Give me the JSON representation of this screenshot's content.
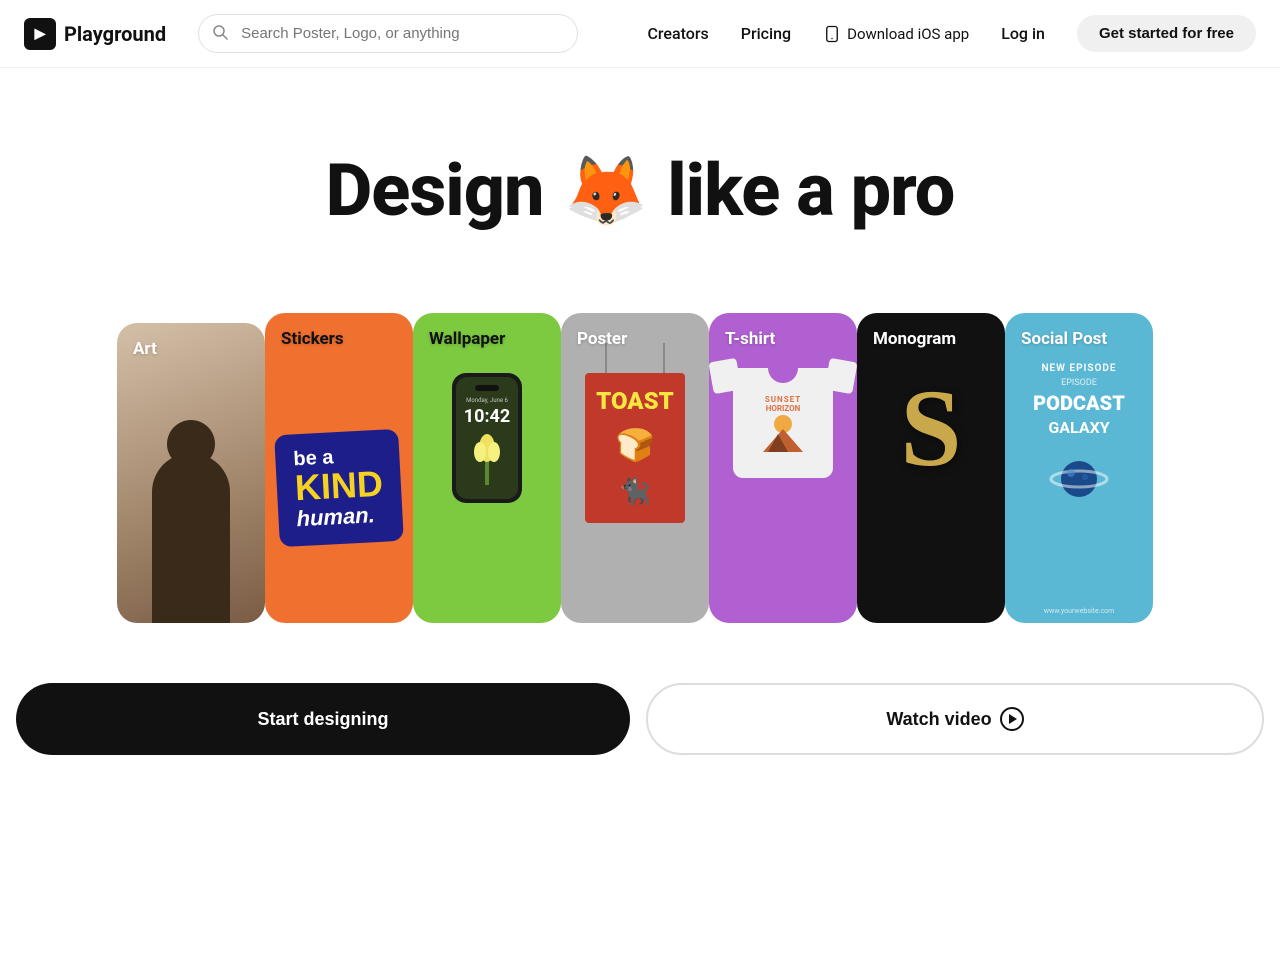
{
  "header": {
    "logo_text": "Playground",
    "search_placeholder": "Search Poster, Logo, or anything",
    "nav": {
      "creators": "Creators",
      "pricing": "Pricing",
      "ios_app": "Download iOS app",
      "login": "Log in",
      "cta": "Get started for free"
    }
  },
  "hero": {
    "title_left": "Design",
    "emoji": "🦊",
    "title_right": "like a pro"
  },
  "categories": [
    {
      "id": "art",
      "label": "Art",
      "label_color": "light"
    },
    {
      "id": "stickers",
      "label": "Stickers",
      "label_color": "dark"
    },
    {
      "id": "wallpaper",
      "label": "Wallpaper",
      "label_color": "dark"
    },
    {
      "id": "poster",
      "label": "Poster",
      "label_color": "light"
    },
    {
      "id": "tshirt",
      "label": "T-shirt",
      "label_color": "light"
    },
    {
      "id": "monogram",
      "label": "Monogram",
      "label_color": "light"
    },
    {
      "id": "social-post",
      "label": "Social Post",
      "label_color": "light"
    }
  ],
  "sticker": {
    "line1": "be a",
    "line2": "KIND",
    "line3": "human."
  },
  "phone": {
    "date": "Monday, June 6",
    "time": "10:42"
  },
  "poster": {
    "title": "TOAST"
  },
  "monogram": {
    "letter": "S"
  },
  "social": {
    "new_episode": "NEW EPISODE",
    "podcast": "PODCAST",
    "galaxy": "GALAXY",
    "website": "www.yourwebsite.com"
  },
  "cta": {
    "start_designing": "Start designing",
    "watch_video": "Watch video"
  }
}
